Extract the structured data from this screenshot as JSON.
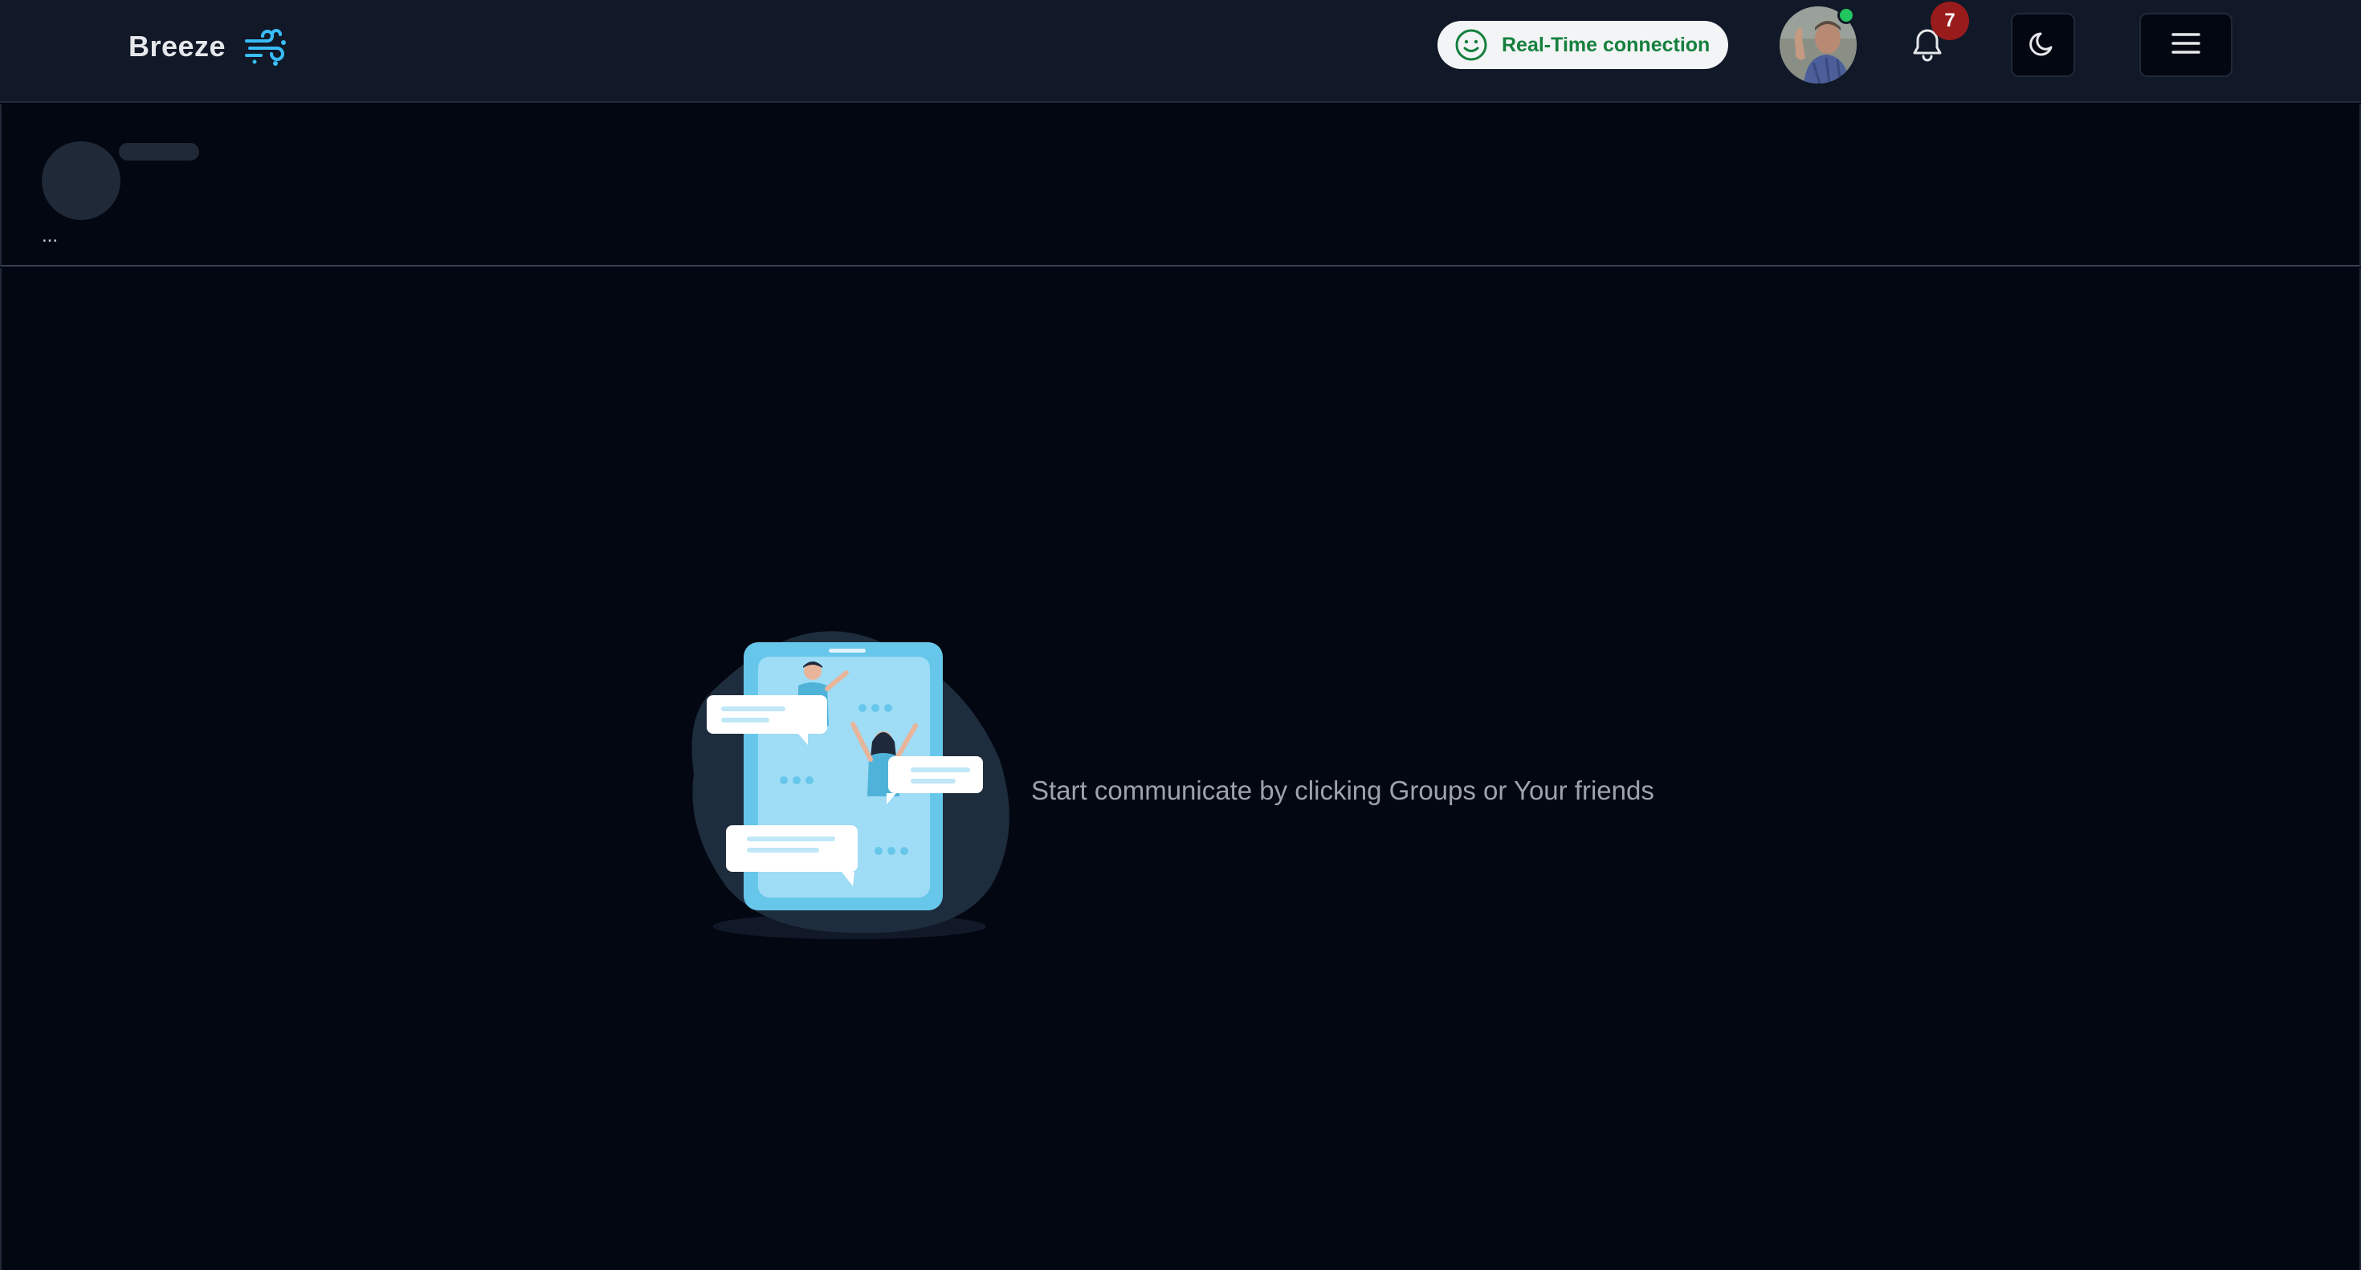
{
  "header": {
    "brand_name": "Breeze",
    "brand_logo_icon": "wind-icon",
    "connection_status": {
      "label": "Real-Time connection",
      "icon": "smile-icon",
      "color": "#15803d"
    },
    "avatar_status": "online",
    "notifications": {
      "icon": "bell-icon",
      "count": "7"
    },
    "theme_toggle_icon": "moon-icon",
    "menu_icon": "hamburger-menu-icon"
  },
  "chat_header": {
    "placeholder_text": "..."
  },
  "empty_state": {
    "message": "Start communicate by clicking Groups or Your friends",
    "illustration": "chat-illustration"
  },
  "colors": {
    "background": "#030712",
    "topbar": "#111827",
    "accent": "#38bdf8",
    "badge": "#991b1b"
  }
}
